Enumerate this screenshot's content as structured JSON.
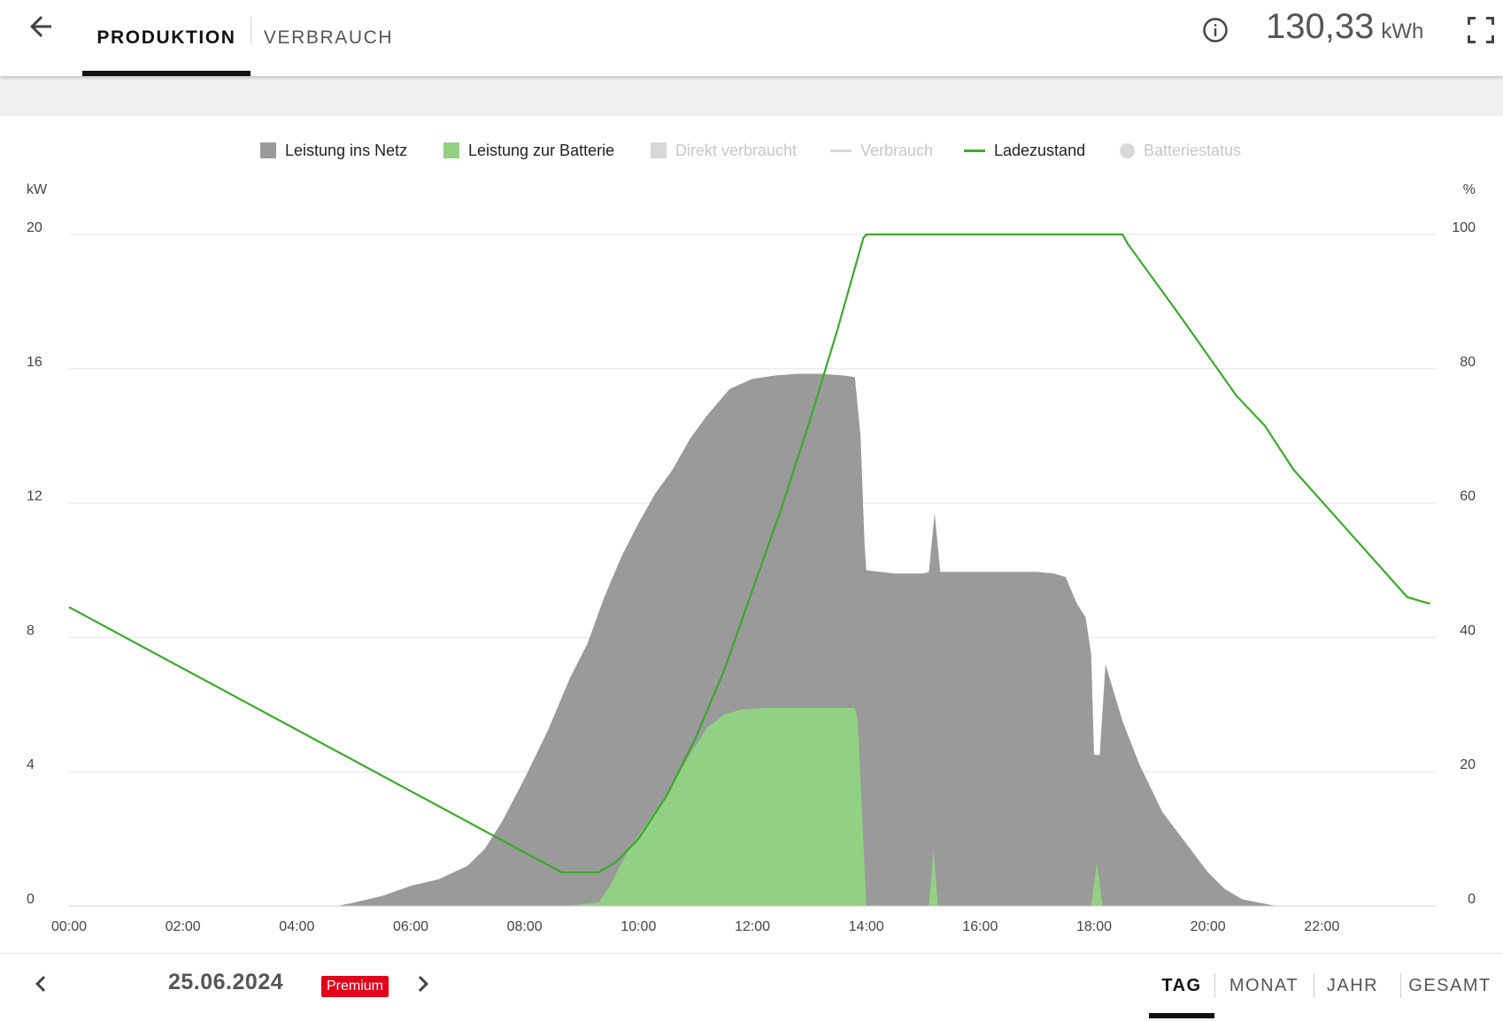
{
  "header": {
    "tabs": [
      {
        "label": "PRODUKTION",
        "active": true
      },
      {
        "label": "VERBRAUCH",
        "active": false
      }
    ],
    "energy_total": {
      "value": "130,33",
      "unit": "kWh"
    },
    "icons": {
      "back": "arrow-left-icon",
      "info": "info-circle-icon",
      "fullscreen": "fullscreen-icon"
    }
  },
  "legend": [
    {
      "label": "Leistung ins Netz",
      "swatch": "box",
      "color": "#9a9a9a",
      "active": true
    },
    {
      "label": "Leistung zur Batterie",
      "swatch": "box",
      "color": "#92d083",
      "active": true
    },
    {
      "label": "Direkt verbraucht",
      "swatch": "box",
      "color": "#d8d8d8",
      "active": false
    },
    {
      "label": "Verbrauch",
      "swatch": "line",
      "color": "#d8d8d8",
      "active": false
    },
    {
      "label": "Ladezustand",
      "swatch": "line",
      "color": "#3aaa2a",
      "active": true
    },
    {
      "label": "Batteriestatus",
      "swatch": "dot",
      "color": "#d8d8d8",
      "active": false
    }
  ],
  "chart_data": {
    "type": "area",
    "x_unit": "hours",
    "x_ticks": [
      "00:00",
      "02:00",
      "04:00",
      "06:00",
      "08:00",
      "10:00",
      "12:00",
      "14:00",
      "16:00",
      "18:00",
      "20:00",
      "22:00"
    ],
    "x_range": [
      0,
      24
    ],
    "y_left": {
      "unit": "kW",
      "ticks": [
        "20",
        "16",
        "12",
        "8",
        "4",
        "0"
      ],
      "range": [
        0,
        20
      ]
    },
    "y_right": {
      "unit": "%",
      "ticks": [
        "100",
        "80",
        "60",
        "40",
        "20",
        "0"
      ],
      "range": [
        0,
        100
      ]
    },
    "grid": true,
    "colors": {
      "netz": "#9a9a9a",
      "batterie": "#92d083",
      "ladezustand": "#3aaa2a",
      "grid": "#e6e6e6",
      "axis_text": "#444"
    },
    "series": [
      {
        "name": "Leistung ins Netz",
        "kind": "area",
        "axis": "left",
        "points": [
          [
            0,
            0
          ],
          [
            4.7,
            0
          ],
          [
            5.0,
            0.1
          ],
          [
            5.5,
            0.3
          ],
          [
            6.0,
            0.6
          ],
          [
            6.5,
            0.8
          ],
          [
            7.0,
            1.2
          ],
          [
            7.3,
            1.7
          ],
          [
            7.6,
            2.5
          ],
          [
            8.0,
            3.8
          ],
          [
            8.4,
            5.2
          ],
          [
            8.8,
            6.8
          ],
          [
            9.1,
            7.8
          ],
          [
            9.4,
            9.2
          ],
          [
            9.7,
            10.4
          ],
          [
            10.0,
            11.4
          ],
          [
            10.3,
            12.3
          ],
          [
            10.6,
            13.0
          ],
          [
            10.9,
            13.9
          ],
          [
            11.2,
            14.6
          ],
          [
            11.6,
            15.4
          ],
          [
            12.0,
            15.7
          ],
          [
            12.4,
            15.8
          ],
          [
            12.8,
            15.85
          ],
          [
            13.2,
            15.85
          ],
          [
            13.6,
            15.8
          ],
          [
            13.8,
            15.75
          ],
          [
            13.9,
            14.0
          ],
          [
            13.97,
            10.8
          ],
          [
            14.0,
            10.0
          ],
          [
            14.5,
            9.9
          ],
          [
            15.0,
            9.9
          ],
          [
            15.1,
            9.95
          ],
          [
            15.2,
            11.7
          ],
          [
            15.3,
            9.95
          ],
          [
            15.6,
            9.95
          ],
          [
            16.0,
            9.95
          ],
          [
            16.5,
            9.95
          ],
          [
            17.0,
            9.95
          ],
          [
            17.3,
            9.9
          ],
          [
            17.5,
            9.8
          ],
          [
            17.7,
            9.0
          ],
          [
            17.85,
            8.6
          ],
          [
            17.95,
            7.5
          ],
          [
            18.0,
            4.5
          ],
          [
            18.1,
            4.5
          ],
          [
            18.2,
            7.2
          ],
          [
            18.5,
            5.5
          ],
          [
            18.8,
            4.2
          ],
          [
            19.2,
            2.8
          ],
          [
            19.6,
            1.9
          ],
          [
            20.0,
            1.0
          ],
          [
            20.3,
            0.5
          ],
          [
            20.6,
            0.2
          ],
          [
            20.9,
            0.1
          ],
          [
            21.2,
            0
          ],
          [
            24,
            0
          ]
        ]
      },
      {
        "name": "Leistung zur Batterie",
        "kind": "area",
        "axis": "left",
        "points": [
          [
            0,
            0
          ],
          [
            8.7,
            0
          ],
          [
            9.0,
            0.05
          ],
          [
            9.3,
            0.1
          ],
          [
            9.5,
            0.6
          ],
          [
            9.8,
            1.6
          ],
          [
            10.2,
            2.6
          ],
          [
            10.6,
            3.6
          ],
          [
            10.9,
            4.5
          ],
          [
            11.2,
            5.3
          ],
          [
            11.5,
            5.7
          ],
          [
            11.8,
            5.85
          ],
          [
            12.2,
            5.9
          ],
          [
            13.0,
            5.9
          ],
          [
            13.8,
            5.9
          ],
          [
            13.85,
            5.5
          ],
          [
            13.92,
            3.0
          ],
          [
            14.0,
            0
          ],
          [
            15.1,
            0
          ],
          [
            15.18,
            1.7
          ],
          [
            15.26,
            0
          ],
          [
            17.95,
            0
          ],
          [
            18.05,
            1.3
          ],
          [
            18.15,
            0
          ],
          [
            24,
            0
          ]
        ]
      },
      {
        "name": "Ladezustand",
        "kind": "line",
        "axis": "right",
        "points": [
          [
            0,
            44.5
          ],
          [
            8.65,
            5.0
          ],
          [
            9.0,
            5.0
          ],
          [
            9.3,
            5.0
          ],
          [
            9.6,
            6.5
          ],
          [
            10.0,
            10.0
          ],
          [
            10.5,
            16.5
          ],
          [
            11.0,
            25.0
          ],
          [
            11.5,
            35.0
          ],
          [
            12.0,
            47.0
          ],
          [
            12.5,
            59.0
          ],
          [
            13.0,
            72.0
          ],
          [
            13.5,
            86.0
          ],
          [
            13.95,
            99.5
          ],
          [
            14.0,
            100
          ],
          [
            18.5,
            100
          ],
          [
            18.6,
            98.5
          ],
          [
            19.5,
            88.0
          ],
          [
            20.5,
            76.0
          ],
          [
            21.0,
            71.5
          ],
          [
            21.5,
            65.0
          ],
          [
            22.5,
            55.5
          ],
          [
            23.5,
            46.0
          ],
          [
            23.9,
            45.0
          ]
        ]
      }
    ]
  },
  "footer": {
    "date": "25.06.2024",
    "premium_badge": "Premium",
    "icons": {
      "prev": "chevron-left-icon",
      "next": "chevron-right-icon"
    },
    "periods": [
      {
        "label": "TAG",
        "active": true
      },
      {
        "label": "MONAT",
        "active": false
      },
      {
        "label": "JAHR",
        "active": false
      },
      {
        "label": "GESAMT",
        "active": false
      }
    ]
  }
}
